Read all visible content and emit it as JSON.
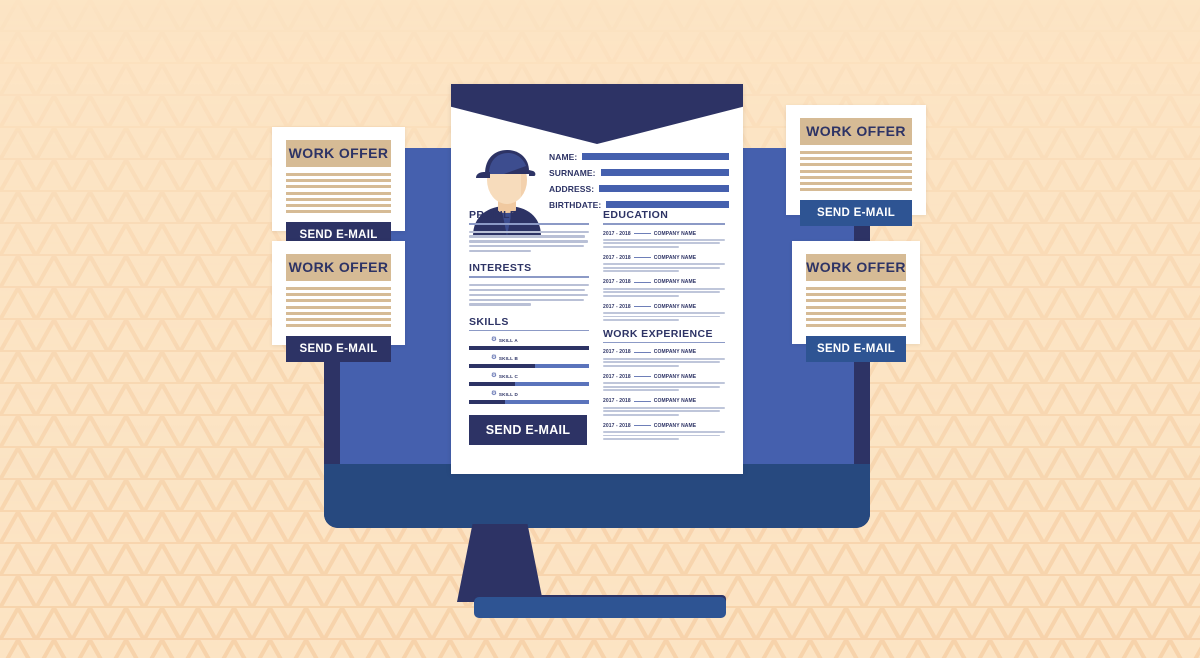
{
  "scene": {
    "background_color": "#FCE4C4",
    "pattern_color": "#F8D5AE",
    "navy": "#2D3365",
    "screen_blue": "#4560AE",
    "bezel_blue": "#27497F",
    "tan": "#D6BB95",
    "button_blue": "#2E5493"
  },
  "monitor": {
    "label": "desktop-monitor"
  },
  "resume": {
    "avatar_alt": "applicant-avatar",
    "info_fields": [
      {
        "label": "NAME:",
        "value": ""
      },
      {
        "label": "SURNAME:",
        "value": ""
      },
      {
        "label": "ADDRESS:",
        "value": ""
      },
      {
        "label": "BIRTHDATE:",
        "value": ""
      }
    ],
    "sections": {
      "profile": {
        "title": "PROFILE",
        "body_line_widths": [
          100,
          97,
          99,
          96,
          52
        ]
      },
      "interests": {
        "title": "INTERESTS",
        "body_line_widths": [
          100,
          97,
          99,
          96,
          52
        ]
      },
      "skills": {
        "title": "SKILLS",
        "items": [
          {
            "name": "SKILL A",
            "level": 100
          },
          {
            "name": "SKILL B",
            "level": 55
          },
          {
            "name": "SKILL C",
            "level": 38
          },
          {
            "name": "SKILL D",
            "level": 30
          }
        ]
      },
      "education": {
        "title": "EDUCATION",
        "entries": [
          {
            "years": "2017 - 2018",
            "company": "COMPANY NAME",
            "line_widths": [
              100,
              96,
              62
            ]
          },
          {
            "years": "2017 - 2018",
            "company": "COMPANY NAME",
            "line_widths": [
              100,
              96,
              62
            ]
          },
          {
            "years": "2017 - 2018",
            "company": "COMPANY NAME",
            "line_widths": [
              100,
              96,
              62
            ]
          },
          {
            "years": "2017 - 2018",
            "company": "COMPANY NAME",
            "line_widths": [
              100,
              96,
              62
            ]
          }
        ]
      },
      "work_experience": {
        "title": "WORK EXPERIENCE",
        "entries": [
          {
            "years": "2017 - 2018",
            "company": "COMPANY NAME",
            "line_widths": [
              100,
              96,
              62
            ]
          },
          {
            "years": "2017 - 2018",
            "company": "COMPANY NAME",
            "line_widths": [
              100,
              96,
              62
            ]
          },
          {
            "years": "2017 - 2018",
            "company": "COMPANY NAME",
            "line_widths": [
              100,
              96,
              62
            ]
          },
          {
            "years": "2017 - 2018",
            "company": "COMPANY NAME",
            "line_widths": [
              100,
              96,
              62
            ]
          }
        ]
      }
    },
    "cta_label": "SEND E-MAIL"
  },
  "offer_cards": [
    {
      "title": "WORK OFFER",
      "button_label": "SEND E-MAIL",
      "button_color": "#2D3365",
      "line_count": 7
    },
    {
      "title": "WORK OFFER",
      "button_label": "SEND E-MAIL",
      "button_color": "#2D3365",
      "line_count": 7
    },
    {
      "title": "WORK OFFER",
      "button_label": "SEND E-MAIL",
      "button_color": "#2E5493",
      "line_count": 7
    },
    {
      "title": "WORK OFFER",
      "button_label": "SEND E-MAIL",
      "button_color": "#2E5493",
      "line_count": 7
    }
  ]
}
